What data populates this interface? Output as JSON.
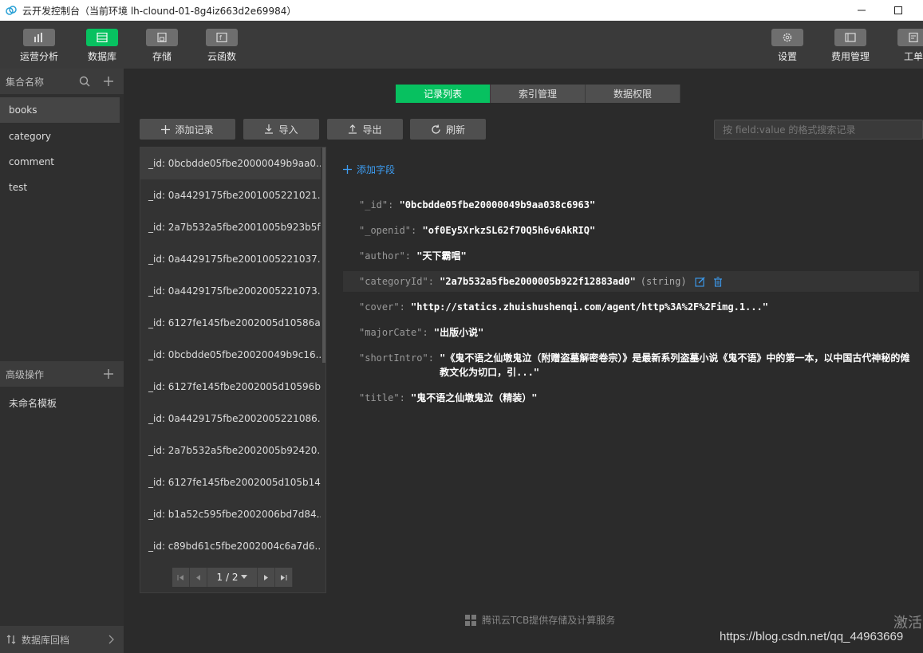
{
  "window": {
    "title": "云开发控制台（当前环境 lh-clound-01-8g4iz663d2e69984）"
  },
  "toolbar": {
    "left": [
      {
        "label": "运营分析",
        "icon": "bar-chart-icon"
      },
      {
        "label": "数据库",
        "icon": "database-icon"
      },
      {
        "label": "存储",
        "icon": "storage-icon"
      },
      {
        "label": "云函数",
        "icon": "function-icon"
      }
    ],
    "right": [
      {
        "label": "设置",
        "icon": "gear-icon"
      },
      {
        "label": "费用管理",
        "icon": "billing-icon"
      },
      {
        "label": "工单",
        "icon": "ticket-icon"
      }
    ],
    "active_color": "#07c160"
  },
  "sidebar": {
    "collections_header": "集合名称",
    "collections": [
      "books",
      "category",
      "comment",
      "test"
    ],
    "advanced_header": "高级操作",
    "advanced_items": [
      "未命名模板"
    ],
    "footer": "数据库回档"
  },
  "tabs": [
    "记录列表",
    "索引管理",
    "数据权限"
  ],
  "actions": {
    "add": "添加记录",
    "import": "导入",
    "export": "导出",
    "refresh": "刷新"
  },
  "search": {
    "placeholder": "按 field:value 的格式搜索记录"
  },
  "records": [
    "_id: 0bcbdde05fbe20000049b9aa0...",
    "_id: 0a4429175fbe2001005221021...",
    "_id: 2a7b532a5fbe2001005b923b5f...",
    "_id: 0a4429175fbe2001005221037...",
    "_id: 0a4429175fbe2002005221073...",
    "_id: 6127fe145fbe2002005d10586a...",
    "_id: 0bcbdde05fbe20020049b9c16...",
    "_id: 6127fe145fbe2002005d10596b...",
    "_id: 0a4429175fbe2002005221086...",
    "_id: 2a7b532a5fbe2002005b92420...",
    "_id: 6127fe145fbe2002005d105b14...",
    "_id: b1a52c595fbe2002006bd7d84...",
    "_id: c89bd61c5fbe2002004c6a7d6..."
  ],
  "pager": {
    "current": "1 / 2"
  },
  "detail": {
    "add_field": "添加字段",
    "fields": [
      {
        "key": "\"_id\": ",
        "value": "\"0bcbdde05fbe20000049b9aa038c6963\""
      },
      {
        "key": "\"_openid\": ",
        "value": "\"of0Ey5XrkzSL62f70Q5h6v6AkRIQ\""
      },
      {
        "key": "\"author\": ",
        "value": "\"天下霸唱\""
      },
      {
        "key": "\"categoryId\": ",
        "value": "\"2a7b532a5fbe2000005b922f12883ad0\"",
        "type": "(string)"
      },
      {
        "key": "\"cover\": ",
        "value": "\"http://statics.zhuishushenqi.com/agent/http%3A%2F%2Fimg.1...\""
      },
      {
        "key": "\"majorCate\": ",
        "value": "\"出版小说\""
      },
      {
        "key": "\"shortIntro\": ",
        "value": "\"《鬼不语之仙墩鬼泣（附赠盗墓解密卷宗）》是最新系列盗墓小说《鬼不语》中的第一本，以中国古代神秘的傩教文化为切口，引...\""
      },
      {
        "key": "\"title\": ",
        "value": "\"鬼不语之仙墩鬼泣（精装）\""
      }
    ]
  },
  "footer_note": "腾讯云TCB提供存储及计算服务",
  "watermark": "https://blog.csdn.net/qq_44963669",
  "activate_text": "激活"
}
